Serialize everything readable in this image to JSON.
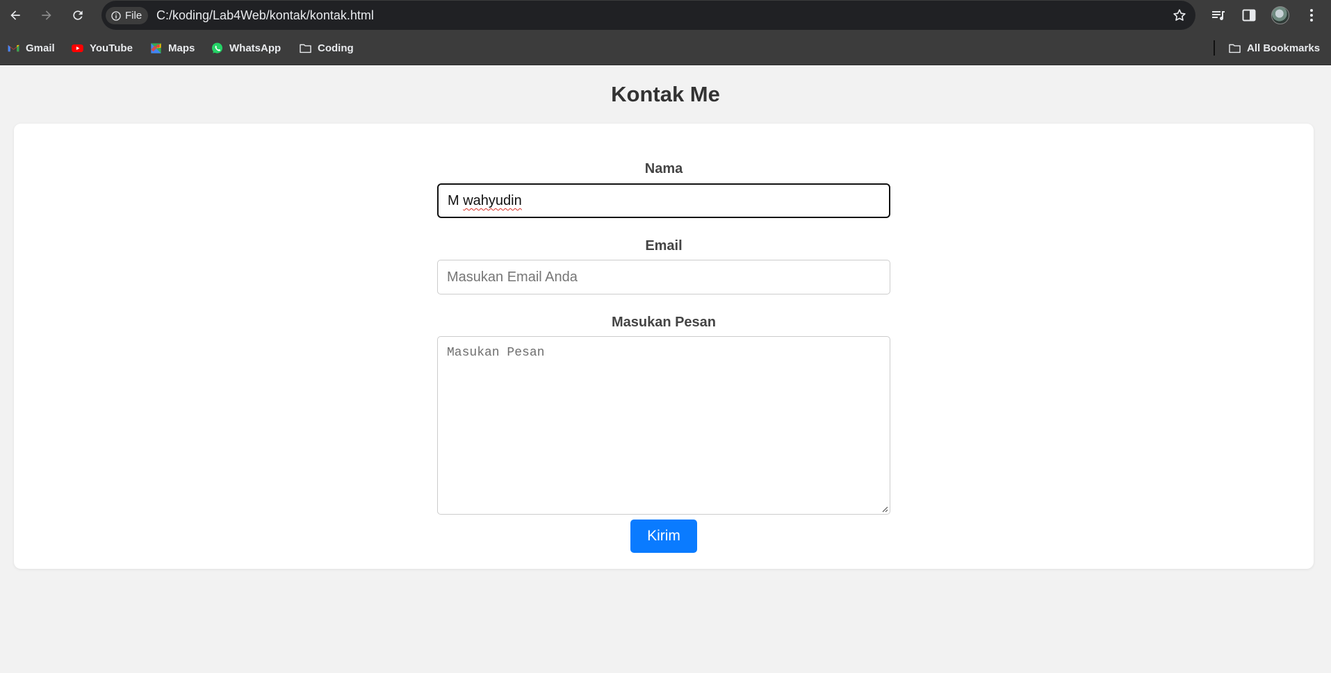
{
  "browser": {
    "url_chip_label": "File",
    "url": "C:/koding/Lab4Web/kontak/kontak.html",
    "bookmarks": [
      {
        "label": "Gmail",
        "icon": "gmail-icon"
      },
      {
        "label": "YouTube",
        "icon": "youtube-icon"
      },
      {
        "label": "Maps",
        "icon": "maps-icon"
      },
      {
        "label": "WhatsApp",
        "icon": "whatsapp-icon"
      },
      {
        "label": "Coding",
        "icon": "folder-icon"
      }
    ],
    "all_bookmarks_label": "All Bookmarks"
  },
  "page": {
    "title": "Kontak Me",
    "form": {
      "nama_label": "Nama",
      "nama_value_first": "M",
      "nama_value_rest": "wahyudin",
      "email_label": "Email",
      "email_placeholder": "Masukan Email Anda",
      "pesan_label": "Masukan Pesan",
      "pesan_placeholder": "Masukan Pesan",
      "submit_label": "Kirim"
    }
  },
  "colors": {
    "accent_button": "#0a7bff",
    "page_background": "#f2f2f2",
    "browser_chrome": "#3c3c3c"
  }
}
